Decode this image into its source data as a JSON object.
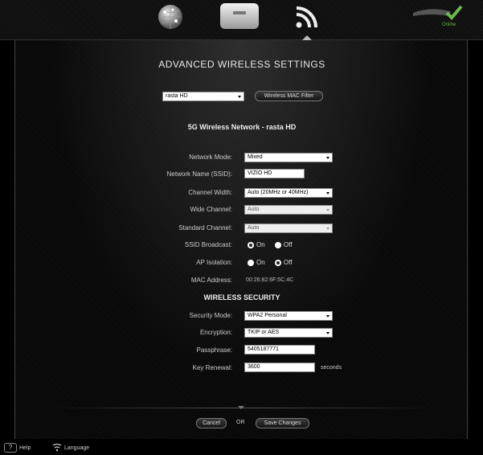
{
  "nav": {
    "icons": [
      "globe-icon",
      "router-icon",
      "wifi-icon"
    ],
    "active": "wifi-icon",
    "status_label": "Online",
    "status_color": "#6fb94a"
  },
  "page": {
    "title": "ADVANCED WIRELESS SETTINGS",
    "network_select_value": "rasta HD",
    "mac_filter_button": "Wireless MAC Filter",
    "network_heading": "5G Wireless Network  -  rasta HD"
  },
  "wireless": {
    "network_mode": {
      "label": "Network Mode:",
      "value": "Mixed"
    },
    "ssid": {
      "label": "Network Name (SSID):",
      "value": "VIZIO HD"
    },
    "channel_width": {
      "label": "Channel Width:",
      "value": "Auto (20MHz or 40MHz)"
    },
    "wide_channel": {
      "label": "Wide Channel:",
      "value": "Auto"
    },
    "standard_channel": {
      "label": "Standard Channel:",
      "value": "Auto"
    },
    "ssid_broadcast": {
      "label": "SSID Broadcast:",
      "on_label": "On",
      "off_label": "Off",
      "selected": "On"
    },
    "ap_isolation": {
      "label": "AP Isolation:",
      "on_label": "On",
      "off_label": "Off",
      "selected": "Off"
    },
    "mac_address": {
      "label": "MAC Address:",
      "value": "00:26:82:6F:5C:4C"
    }
  },
  "security": {
    "heading": "WIRELESS SECURITY",
    "mode": {
      "label": "Security Mode:",
      "value": "WPA2 Personal"
    },
    "encryption": {
      "label": "Encryption:",
      "value": "TKIP or AES"
    },
    "passphrase": {
      "label": "Passphrase:",
      "value": "5405187771"
    },
    "key_renewal": {
      "label": "Key Renewal:",
      "value": "3600",
      "unit": "seconds"
    }
  },
  "actions": {
    "cancel": "Cancel",
    "or": "OR",
    "save": "Save Changes"
  },
  "footer": {
    "help": "Help",
    "help_icon_glyph": "?",
    "language": "Language"
  }
}
